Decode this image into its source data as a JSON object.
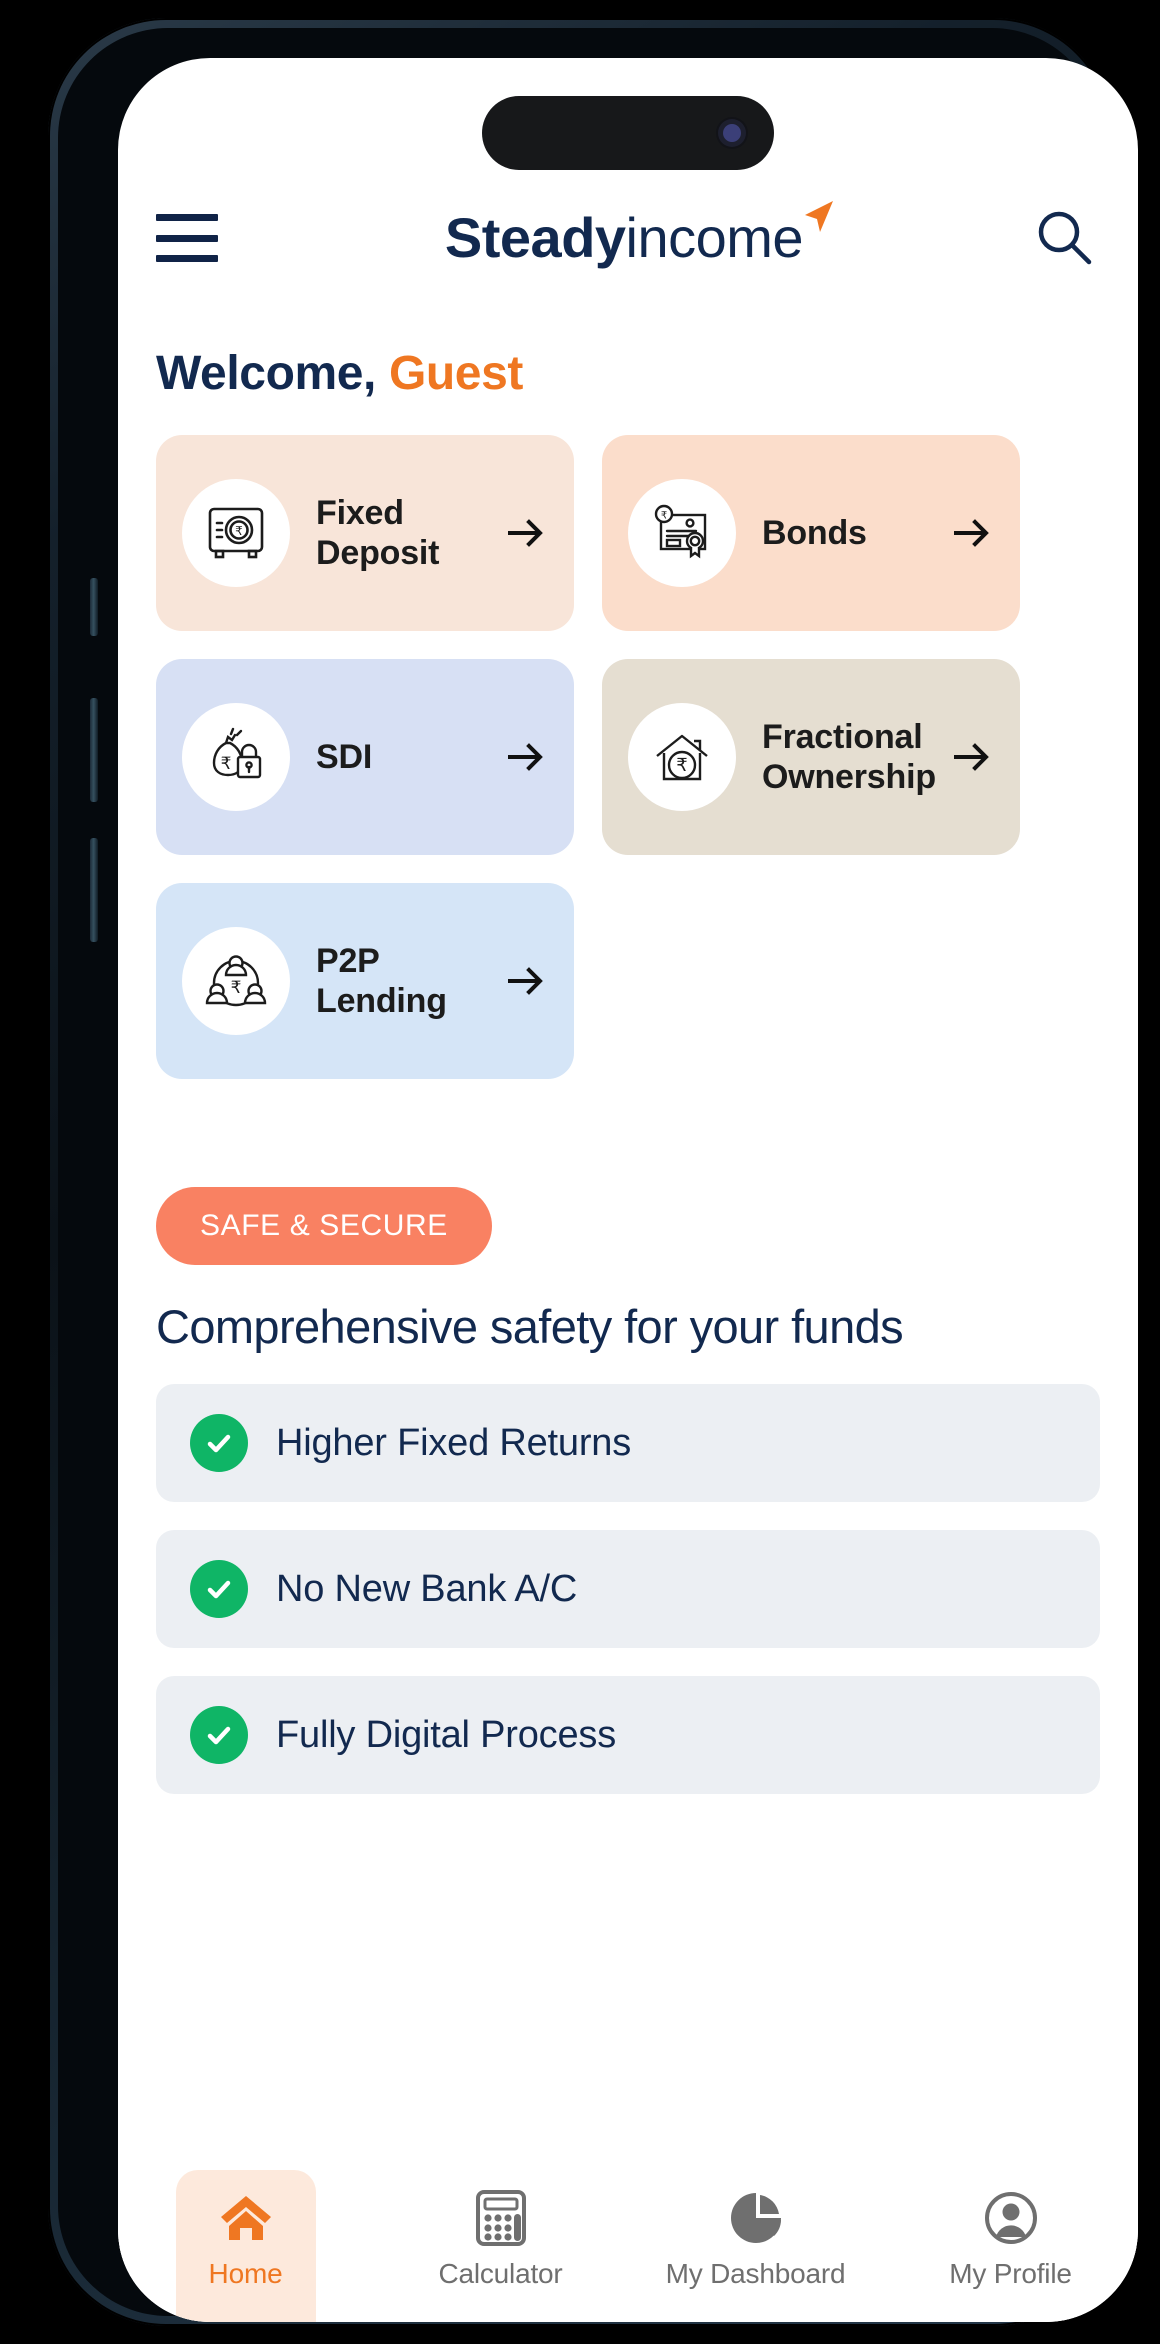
{
  "header": {
    "menu_icon": "hamburger-icon",
    "brand_bold": "Steady",
    "brand_light": "income",
    "brand_mark": "orange-arrow-icon",
    "search_icon": "search-icon"
  },
  "welcome": {
    "greeting": "Welcome,",
    "user": "Guest"
  },
  "products": [
    {
      "label": "Fixed Deposit",
      "icon": "safe-vault-rupee-icon",
      "bg": "#f8e5d9",
      "arrow": "arrow-right-icon"
    },
    {
      "label": "Bonds",
      "icon": "certificate-rupee-icon",
      "bg": "#fbddcb",
      "arrow": "arrow-right-icon"
    },
    {
      "label": "SDI",
      "icon": "money-bag-lock-icon",
      "bg": "#d7e0f4",
      "arrow": "arrow-right-icon"
    },
    {
      "label": "Fractional Ownership",
      "icon": "house-rupee-icon",
      "bg": "#e5ded1",
      "arrow": "arrow-right-icon"
    },
    {
      "label": "P2P Lending",
      "icon": "people-network-rupee-icon",
      "bg": "#d5e5f7",
      "arrow": "arrow-right-icon"
    }
  ],
  "safety": {
    "badge": "SAFE & SECURE",
    "badge_color": "#f98162",
    "title": "Comprehensive safety for your funds",
    "features": [
      {
        "text": "Higher Fixed Returns",
        "icon": "check-circle-icon"
      },
      {
        "text": "No New Bank A/C",
        "icon": "check-circle-icon"
      },
      {
        "text": "Fully Digital Process",
        "icon": "check-circle-icon"
      }
    ],
    "check_color": "#0fb566"
  },
  "bottom_nav": {
    "active_color": "#ef7722",
    "inactive_color": "#6f6f6f",
    "items": [
      {
        "label": "Home",
        "icon": "home-icon",
        "active": true
      },
      {
        "label": "Calculator",
        "icon": "calculator-icon",
        "active": false
      },
      {
        "label": "My Dashboard",
        "icon": "pie-chart-icon",
        "active": false
      },
      {
        "label": "My Profile",
        "icon": "user-circle-icon",
        "active": false
      }
    ]
  }
}
